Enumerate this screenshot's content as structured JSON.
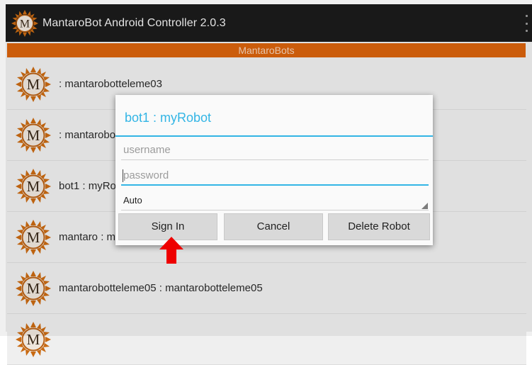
{
  "app": {
    "title": "MantaroBot Android Controller 2.0.3",
    "logo_icon": "mantaro-m-logo",
    "menu_icon": "overflow-menu-icon"
  },
  "colors": {
    "action_bar": "#1b1b1b",
    "accent_orange": "#d8620c",
    "holo_blue": "#33b5e5",
    "annotation_red": "#ee0000"
  },
  "list": {
    "header": "MantaroBots",
    "items": [
      {
        "label": ": mantarobotteleme03",
        "icon": "mantaro-m-logo"
      },
      {
        "label": ": mantarobotteleme04",
        "icon": "mantaro-m-logo"
      },
      {
        "label": "bot1 : myRobot",
        "icon": "mantaro-m-logo"
      },
      {
        "label": "mantaro : mantaro",
        "icon": "mantaro-m-logo"
      },
      {
        "label": "mantarobotteleme05 : mantarobotteleme05",
        "icon": "mantaro-m-logo"
      },
      {
        "label": "",
        "icon": "mantaro-m-logo"
      }
    ]
  },
  "dialog": {
    "title": "bot1 : myRobot",
    "username": {
      "value": "",
      "placeholder": "username"
    },
    "password": {
      "value": "",
      "placeholder": "password"
    },
    "mode": {
      "selected": "Auto"
    },
    "buttons": {
      "sign_in": "Sign In",
      "cancel": "Cancel",
      "delete": "Delete Robot"
    }
  },
  "annotation": {
    "icon": "red-up-arrow-icon",
    "target": "Sign In"
  }
}
